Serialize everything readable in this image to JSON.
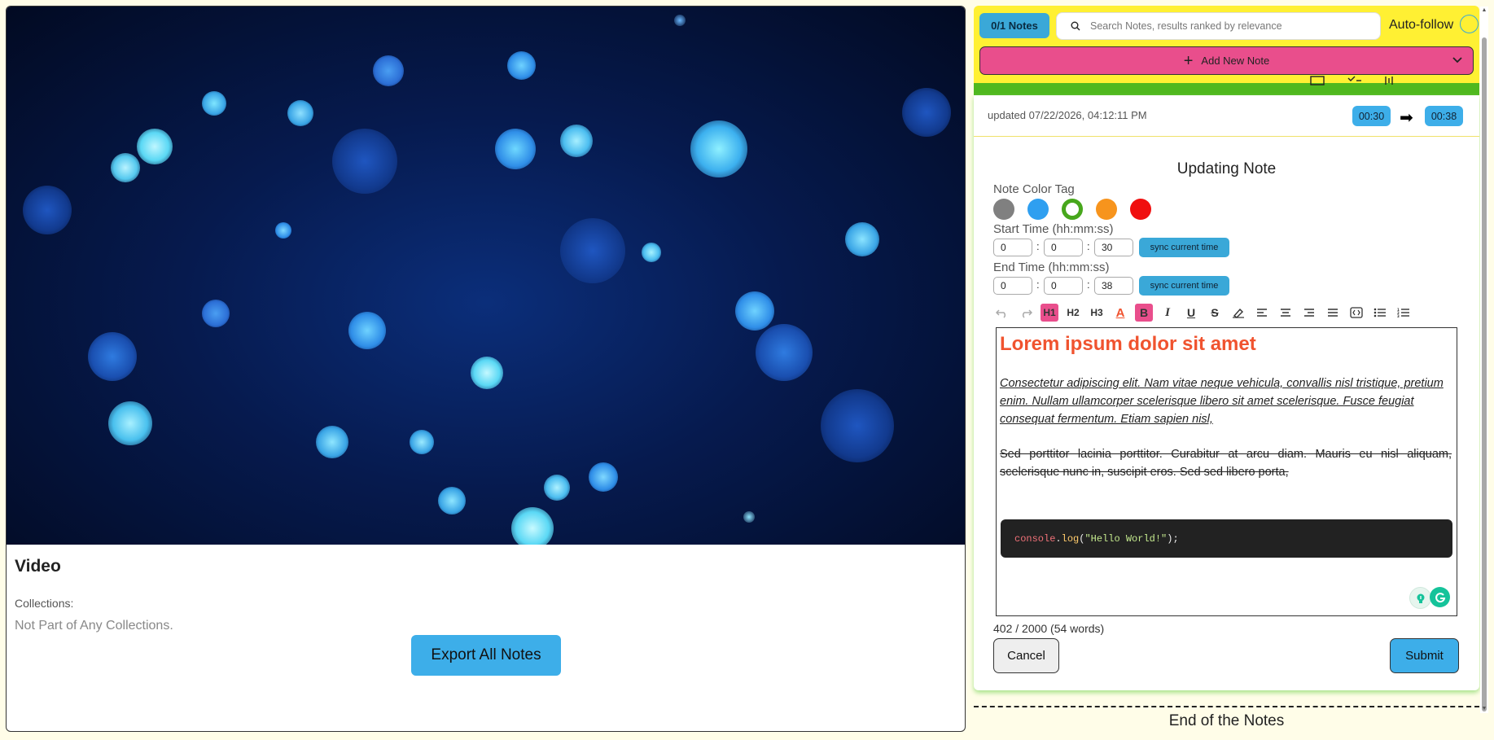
{
  "video": {
    "title": "Video",
    "collections_label": "Collections:",
    "collections_value": "Not Part of Any Collections.",
    "export_label": "Export All Notes"
  },
  "topbar": {
    "notes_count": "0/1 Notes",
    "search_placeholder": "Search Notes, results ranked by relevance",
    "autofollow_label": "Auto-follow",
    "add_note_label": "Add New Note"
  },
  "note": {
    "updated": "updated 07/22/2026, 04:12:11 PM",
    "start_badge": "00:30",
    "end_badge": "00:38"
  },
  "form": {
    "title": "Updating Note",
    "color_tag_label": "Note Color Tag",
    "colors": [
      "#808080",
      "#2f9ff0",
      "#47a71c",
      "#f7941d",
      "#f00f0f"
    ],
    "selected_color_index": 2,
    "start_label": "Start Time (hh:mm:ss)",
    "start": {
      "h": "0",
      "m": "0",
      "s": "30"
    },
    "end_label": "End Time (hh:mm:ss)",
    "end": {
      "h": "0",
      "m": "0",
      "s": "38"
    },
    "sync_label": "sync current time",
    "toolbar_icons": [
      "undo-icon",
      "redo-icon",
      "heading1-icon",
      "heading2-icon",
      "heading3-icon",
      "text-color-icon",
      "bold-icon",
      "italic-icon",
      "underline-icon",
      "strikethrough-icon",
      "highlight-icon",
      "align-left-icon",
      "align-center-icon",
      "align-right-icon",
      "align-justify-icon",
      "code-block-icon",
      "bullet-list-icon",
      "ordered-list-icon"
    ],
    "toolbar_text": {
      "h1": "H1",
      "h2": "H2",
      "h3": "H3",
      "color": "A",
      "bold": "B",
      "italic": "I",
      "underline": "U",
      "strike": "S"
    },
    "editor": {
      "heading": "Lorem ipsum dolor sit amet",
      "paragraph1": "Consectetur adipiscing elit. Nam vitae neque vehicula, convallis nisl tristique, pretium enim. Nullam ullamcorper scelerisque libero sit amet scelerisque. Fusce feugiat consequat fermentum. Etiam sapien nisl,",
      "paragraph2": "Sed porttitor lacinia porttitor. Curabitur at arcu diam. Mauris eu nisl aliquam, scelerisque nunc in, suscipit eros. Sed sed libero porta,",
      "code_obj": "console",
      "code_dot": ".",
      "code_fn": "log",
      "code_open": "(",
      "code_str": "\"Hello World!\"",
      "code_close": ");"
    },
    "char_count": "402 / 2000 (54 words)",
    "cancel_label": "Cancel",
    "submit_label": "Submit"
  },
  "footer": {
    "end_text": "End of the Notes"
  },
  "colors": {
    "topbar_bg": "#fff033",
    "add_note_bg": "#e94e8c",
    "accent_blue": "#3daee9",
    "green_strip": "#4fb81e",
    "heading_orange": "#f0532f"
  }
}
